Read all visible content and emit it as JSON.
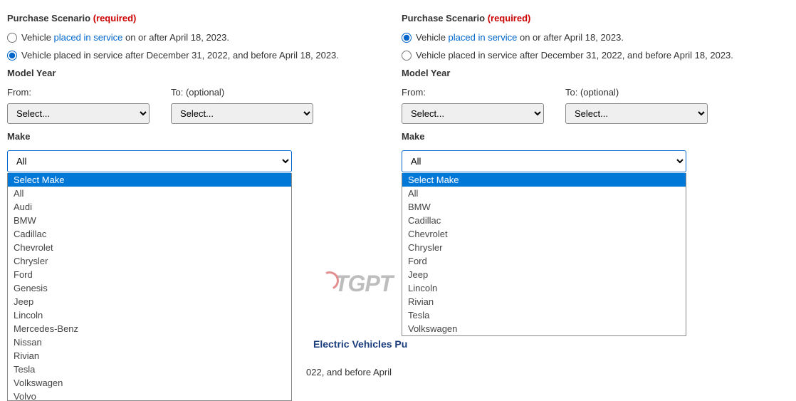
{
  "left": {
    "scenario_header": "Purchase Scenario",
    "required_text": "(required)",
    "radio1_prefix": "Vehicle ",
    "radio1_link": "placed in service",
    "radio1_suffix": " on or after April 18, 2023.",
    "radio2": "Vehicle placed in service after December 31, 2022, and before April 18, 2023.",
    "model_year_header": "Model Year",
    "from_label": "From:",
    "to_label": "To: (optional)",
    "select_placeholder": "Select...",
    "make_header": "Make",
    "make_current": "All",
    "make_options": [
      "Select Make",
      "All",
      "Audi",
      "BMW",
      "Cadillac",
      "Chevrolet",
      "Chrysler",
      "Ford",
      "Genesis",
      "Jeep",
      "Lincoln",
      "Mercedes-Benz",
      "Nissan",
      "Rivian",
      "Tesla",
      "Volkswagen",
      "Volvo"
    ]
  },
  "right": {
    "scenario_header": "Purchase Scenario",
    "required_text": "(required)",
    "radio1_prefix": "Vehicle ",
    "radio1_link": "placed in service",
    "radio1_suffix": " on or after April 18, 2023.",
    "radio2": "Vehicle placed in service after December 31, 2022, and before April 18, 2023.",
    "model_year_header": "Model Year",
    "from_label": "From:",
    "to_label": "To: (optional)",
    "select_placeholder": "Select...",
    "make_header": "Make",
    "make_current": "All",
    "make_options": [
      "Select Make",
      "All",
      "BMW",
      "Cadillac",
      "Chevrolet",
      "Chrysler",
      "Ford",
      "Jeep",
      "Lincoln",
      "Rivian",
      "Tesla",
      "Volkswagen"
    ]
  },
  "watermark": "TGPT",
  "bg_text1": "Electric Vehicles Pu",
  "bg_text2": "022, and before April "
}
